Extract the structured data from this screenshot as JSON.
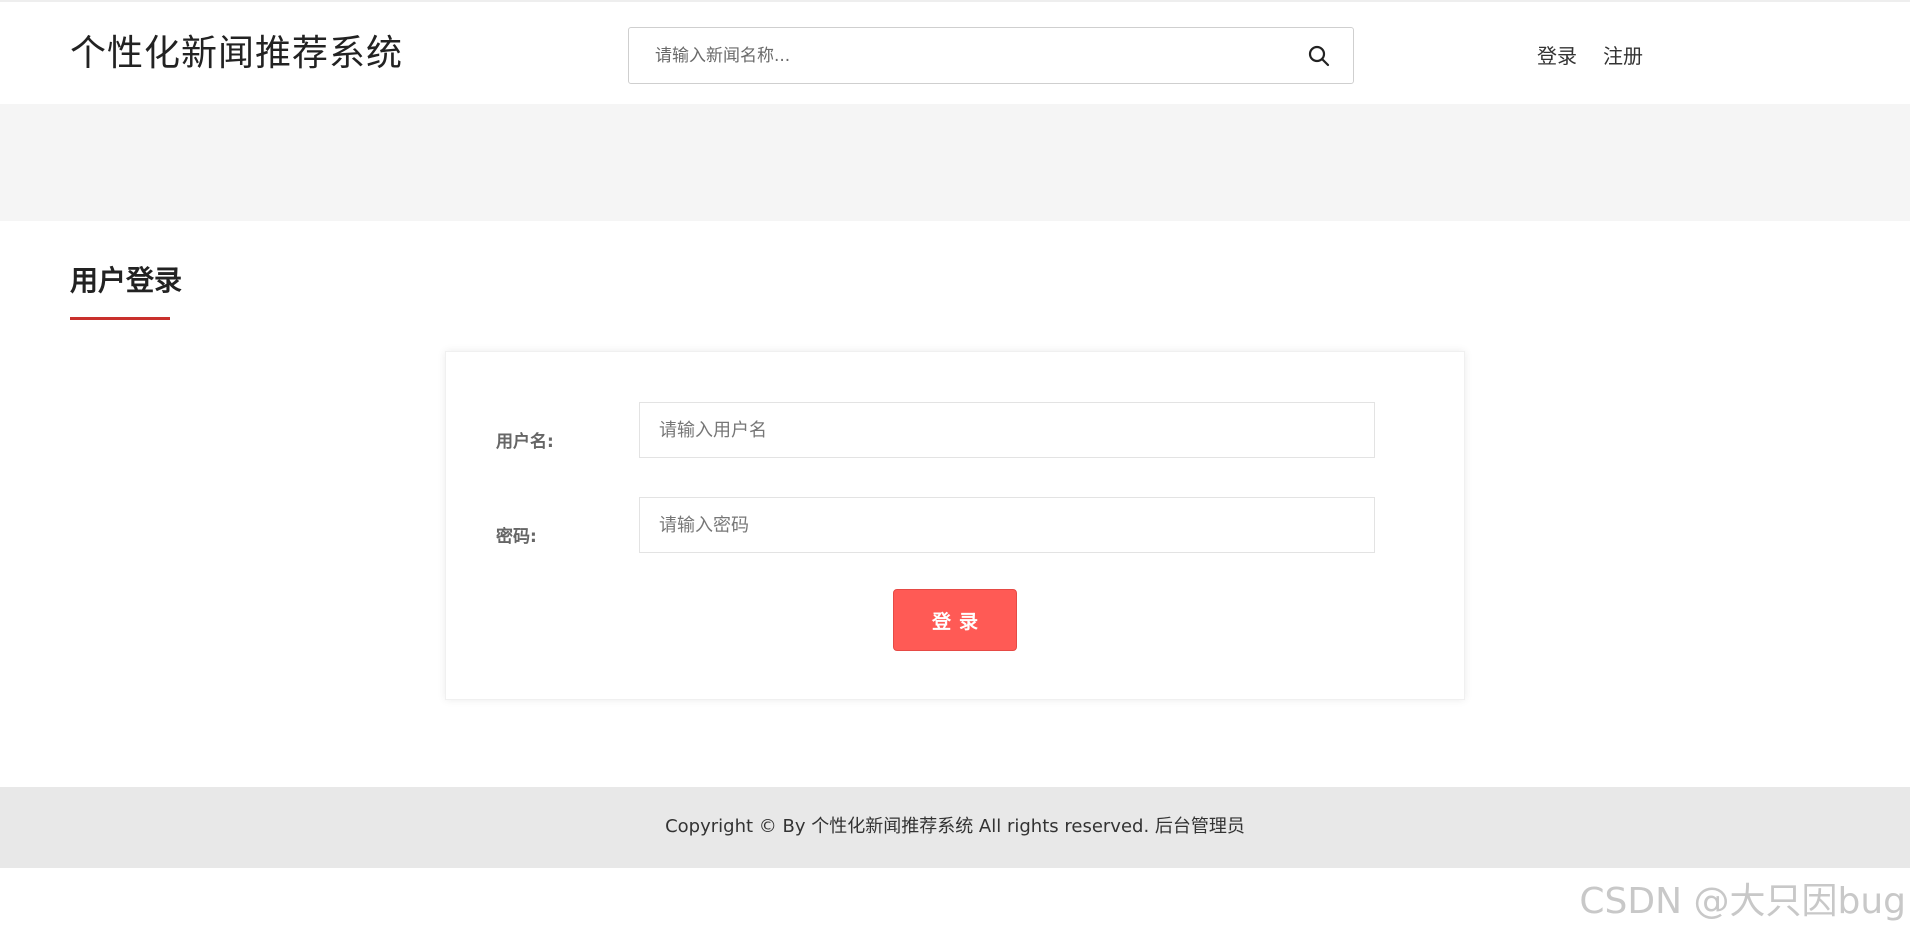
{
  "header": {
    "site_title": "个性化新闻推荐系统",
    "search_placeholder": "请输入新闻名称...",
    "search_icon": "search-icon",
    "nav": {
      "login": "登录",
      "register": "注册"
    }
  },
  "section": {
    "title": "用户登录"
  },
  "login_form": {
    "username_label": "用户名:",
    "username_placeholder": "请输入用户名",
    "password_label": "密码:",
    "password_placeholder": "请输入密码",
    "submit_label": "登录"
  },
  "footer": {
    "copyright": "Copyright © By 个性化新闻推荐系统 All rights reserved.",
    "admin_link": "后台管理员"
  },
  "watermark": "CSDN @大只因bug",
  "colors": {
    "accent": "#c9302c",
    "button": "#ff5a55",
    "banner": "#f5f5f5",
    "footer": "#e8e8e8"
  }
}
